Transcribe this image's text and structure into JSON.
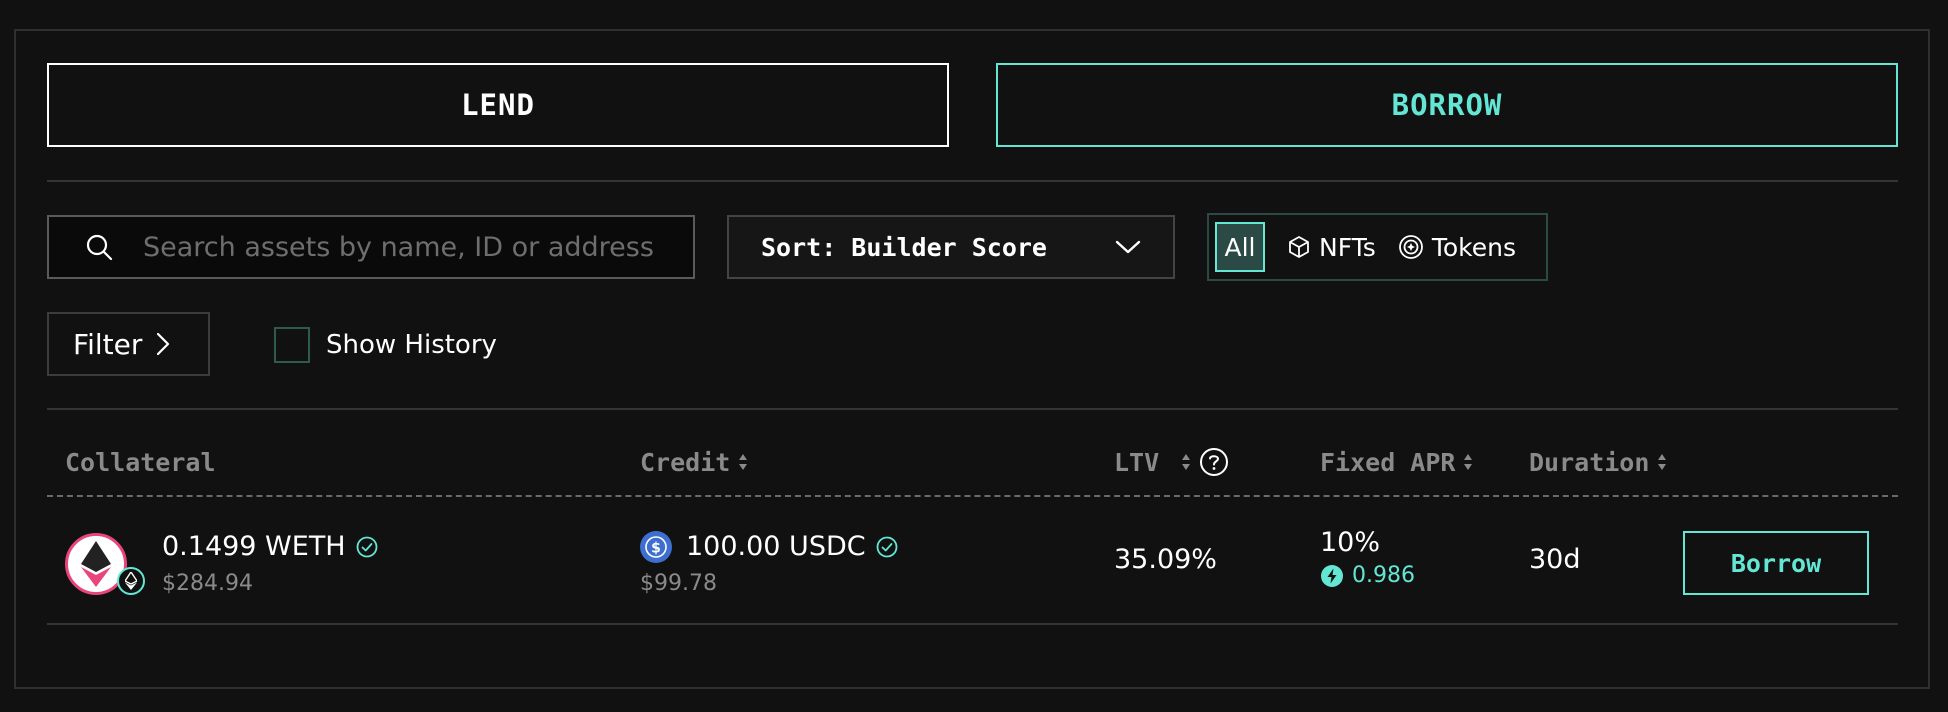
{
  "tabs": {
    "lend_label": "LEND",
    "borrow_label": "BORROW"
  },
  "search": {
    "placeholder": "Search assets by name, ID or address",
    "value": ""
  },
  "sort": {
    "label": "Sort: Builder Score"
  },
  "asset_type": {
    "all_label": "All",
    "nfts_label": "NFTs",
    "tokens_label": "Tokens",
    "selected": "All"
  },
  "filter": {
    "label": "Filter"
  },
  "history": {
    "label": "Show History",
    "checked": false
  },
  "table": {
    "headers": {
      "collateral": "Collateral",
      "credit": "Credit",
      "ltv": "LTV",
      "apr": "Fixed APR",
      "duration": "Duration"
    },
    "rows": [
      {
        "collateral_amount": "0.1499 WETH",
        "collateral_usd": "$284.94",
        "credit_amount": "100.00 USDC",
        "credit_usd": "$99.78",
        "ltv": "35.09%",
        "apr": "10%",
        "apr_score": "0.986",
        "duration": "30d",
        "action_label": "Borrow"
      }
    ]
  },
  "colors": {
    "accent": "#63e6d4",
    "background": "#111111",
    "usdc": "#3d6fd1",
    "weth_ring": "#e8457a"
  },
  "icons": [
    "search-icon",
    "chevron-down-icon",
    "cube-icon",
    "token-icon",
    "chevron-right-icon",
    "sort-icon",
    "help-icon",
    "eth-icon",
    "verified-icon",
    "usdc-icon",
    "score-icon"
  ]
}
